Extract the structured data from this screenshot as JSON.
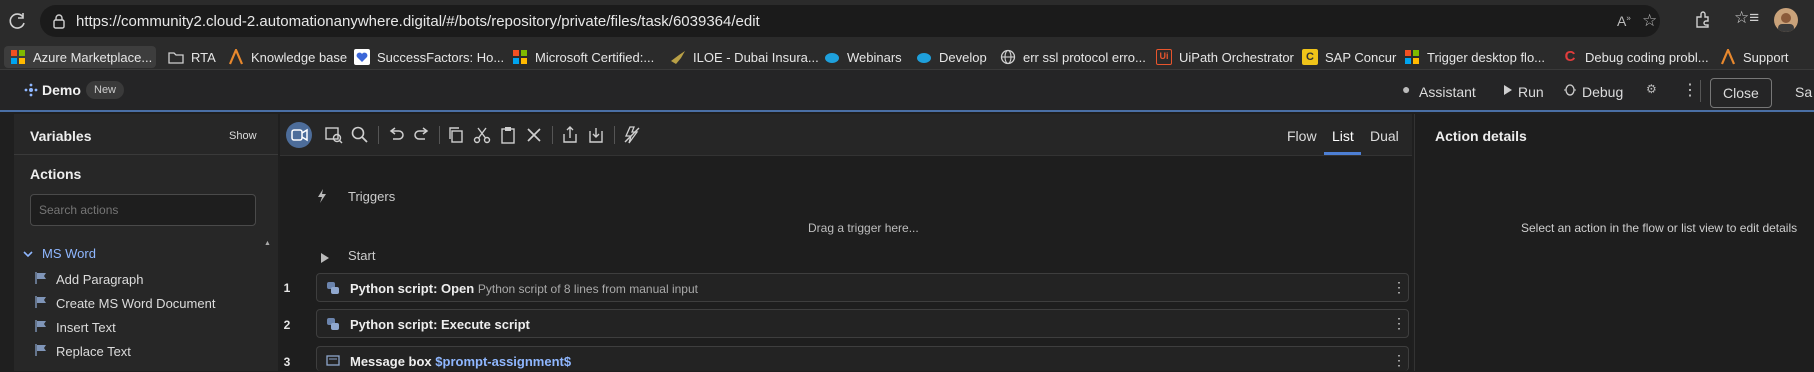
{
  "browser": {
    "url": "https://community2.cloud-2.automationanywhere.digital/#/bots/repository/private/files/task/6039364/edit",
    "bookmarks": [
      {
        "label": "Azure Marketplace...",
        "icon": "microsoft-logo-icon"
      },
      {
        "label": "RTA",
        "icon": "folder-icon"
      },
      {
        "label": "Knowledge base",
        "icon": "aa-logo-icon"
      },
      {
        "label": "SuccessFactors: Ho...",
        "icon": "heart-icon"
      },
      {
        "label": "Microsoft Certified:...",
        "icon": "microsoft-logo-icon"
      },
      {
        "label": "ILOE - Dubai Insura...",
        "icon": "bird-icon"
      },
      {
        "label": "Webinars",
        "icon": "salesforce-cloud-icon"
      },
      {
        "label": "Develop",
        "icon": "salesforce-cloud-icon"
      },
      {
        "label": "err ssl protocol erro...",
        "icon": "globe-icon"
      },
      {
        "label": "UiPath Orchestrator",
        "icon": "uipath-icon"
      },
      {
        "label": "SAP Concur",
        "icon": "concur-icon"
      },
      {
        "label": "Trigger desktop flo...",
        "icon": "microsoft-logo-icon"
      },
      {
        "label": "Debug coding probl...",
        "icon": "c-logo-icon"
      },
      {
        "label": "Support",
        "icon": "aa-logo-icon"
      }
    ]
  },
  "header": {
    "title": "Demo",
    "badge": "New",
    "assistant": "Assistant",
    "run": "Run",
    "debug": "Debug",
    "close": "Close",
    "save": "Sa"
  },
  "left": {
    "variables": "Variables",
    "show": "Show",
    "actions": "Actions",
    "search_placeholder": "Search actions",
    "group": "MS Word",
    "items": [
      "Add Paragraph",
      "Create MS Word Document",
      "Insert Text",
      "Replace Text"
    ]
  },
  "toolbar": {
    "views": [
      "Flow",
      "List",
      "Dual"
    ],
    "active_view": "List"
  },
  "canvas": {
    "triggers": "Triggers",
    "drag": "Drag a trigger here...",
    "start": "Start",
    "steps": [
      {
        "num": "1",
        "title": "Python script: Open",
        "detail": "Python script of 8 lines from manual input"
      },
      {
        "num": "2",
        "title": "Python script: Execute script",
        "detail": ""
      },
      {
        "num": "3",
        "title": "Message box",
        "detail": "$prompt-assignment$"
      }
    ]
  },
  "right": {
    "title": "Action details",
    "hint": "Select an action in the flow or list view to edit details"
  }
}
